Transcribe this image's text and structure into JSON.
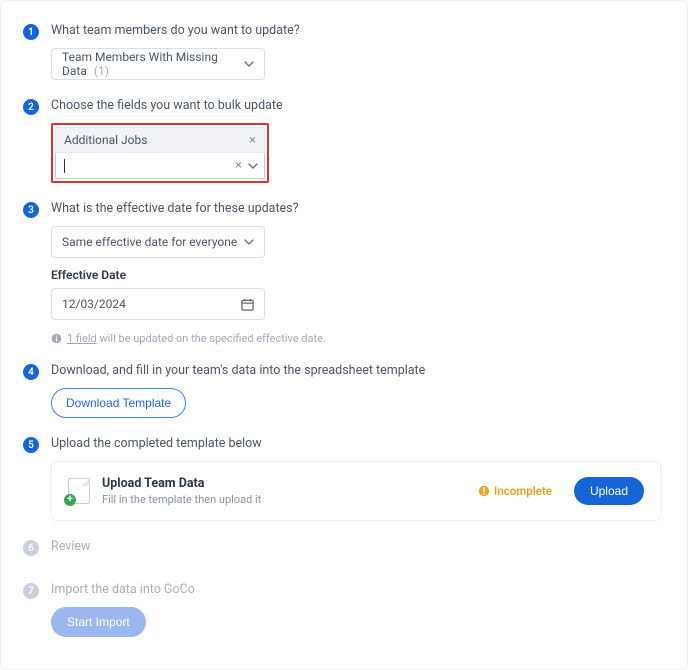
{
  "steps": {
    "s1": {
      "num": "1",
      "title": "What team members do you want to update?",
      "select_label": "Team Members With Missing Data",
      "select_count": "(1)"
    },
    "s2": {
      "num": "2",
      "title": "Choose the fields you want to bulk update",
      "selected_field": "Additional Jobs"
    },
    "s3": {
      "num": "3",
      "title": "What is the effective date for these updates?",
      "mode": "Same effective date for everyone",
      "date_label": "Effective Date",
      "date_value": "12/03/2024",
      "note_field": "1 field",
      "note_rest": " will be updated on the specified effective date."
    },
    "s4": {
      "num": "4",
      "title": "Download, and fill in your team's data into the spreadsheet template",
      "button": "Download Template"
    },
    "s5": {
      "num": "5",
      "title": "Upload the completed template below",
      "upload_heading": "Upload Team Data",
      "upload_sub": "Fill in the template then upload it",
      "status": "Incomplete",
      "button": "Upload"
    },
    "s6": {
      "num": "6",
      "title": "Review"
    },
    "s7": {
      "num": "7",
      "title": "Import the data into GoCo",
      "button": "Start Import"
    }
  }
}
